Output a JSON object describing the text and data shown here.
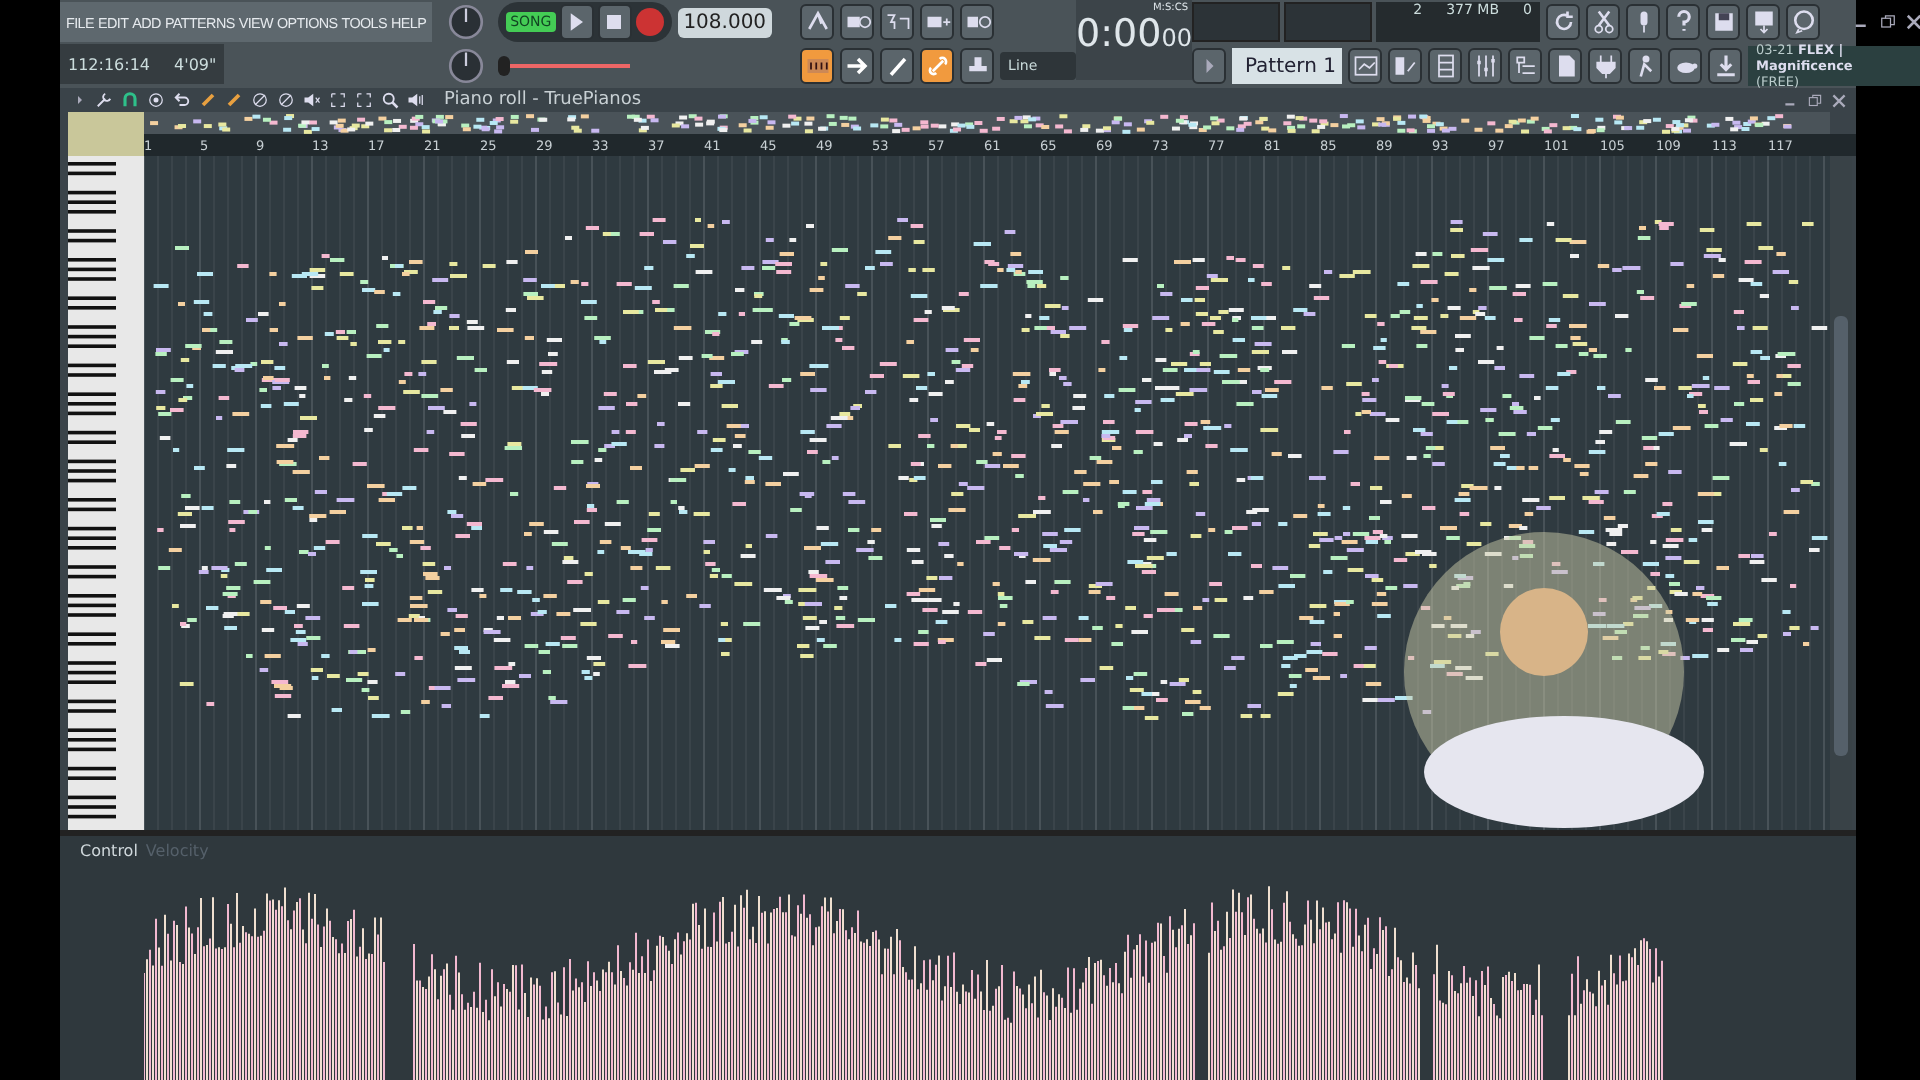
{
  "menu": [
    "FILE",
    "EDIT",
    "ADD",
    "PATTERNS",
    "VIEW",
    "OPTIONS",
    "TOOLS",
    "HELP"
  ],
  "hint_bar": {
    "position": "112:16:14",
    "time": "4'09\""
  },
  "transport": {
    "mode": "SONG",
    "song_mode": true,
    "recording": false,
    "tempo": "108.000",
    "time_main": "0:00",
    "time_small": "00",
    "time_label": "M:S:CS"
  },
  "master_pitch": {
    "level": 0.0
  },
  "monitor": {
    "cpu": "2",
    "memory": "377 MB",
    "voices": "0"
  },
  "tool_buttons_top": [
    {
      "on": false
    },
    {
      "on": false
    },
    {
      "on": false
    },
    {
      "on": false
    },
    {
      "on": false
    }
  ],
  "tool_buttons_bottom": [
    {
      "on": true
    },
    {
      "on": false
    },
    {
      "on": false
    },
    {
      "on": true
    },
    {
      "on": false
    }
  ],
  "snap": "Line",
  "pattern": "Pattern 1",
  "hint_panel": {
    "tag": "03-21",
    "text": "FLEX | Magnificence",
    "sub": "(FREE)"
  },
  "piano_roll": {
    "title": "Piano roll - TruePianos",
    "ruler": [
      "1",
      "5",
      "9",
      "13",
      "17",
      "21",
      "25",
      "29",
      "33",
      "37",
      "41",
      "45",
      "49",
      "53",
      "57",
      "61",
      "65",
      "69",
      "73",
      "77",
      "81",
      "85",
      "89",
      "93",
      "97",
      "101",
      "105",
      "109",
      "113",
      "117"
    ]
  },
  "control": {
    "label": "Control",
    "target": "Velocity"
  }
}
